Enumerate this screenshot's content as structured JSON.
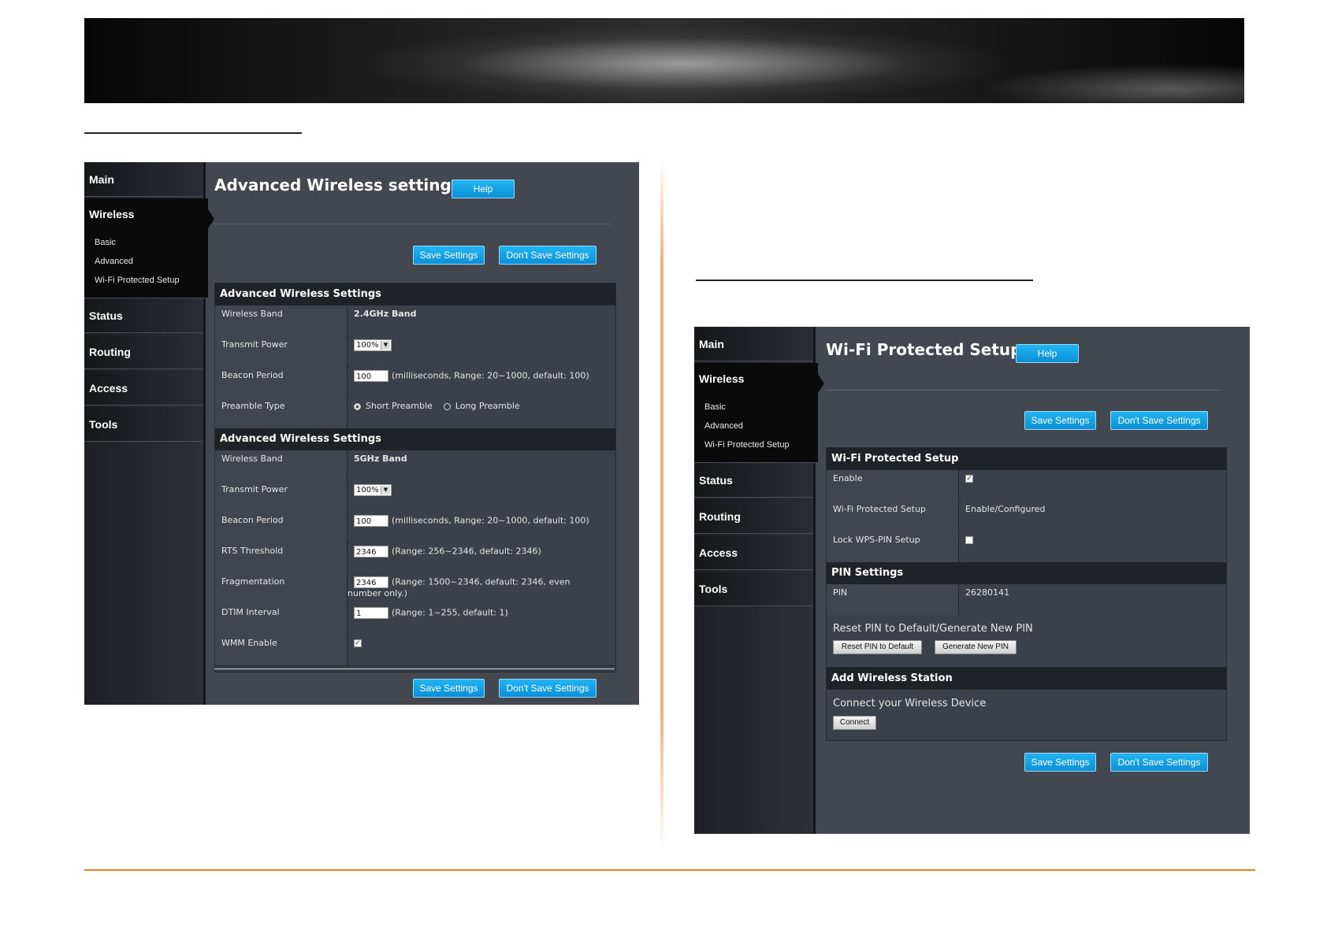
{
  "nav": {
    "main": "Main",
    "wireless": "Wireless",
    "sub": [
      "Basic",
      "Advanced",
      "Wi-Fi Protected Setup"
    ],
    "status": "Status",
    "routing": "Routing",
    "access": "Access",
    "tools": "Tools"
  },
  "advanced": {
    "title": "Advanced Wireless settings",
    "help": "Help",
    "save": "Save Settings",
    "dont_save": "Don't Save Settings",
    "section1": {
      "header": "Advanced Wireless Settings",
      "band_label": "Wireless Band",
      "band_value": "2.4GHz Band",
      "power_label": "Transmit Power",
      "power_value": "100%",
      "beacon_label": "Beacon Period",
      "beacon_value": "100",
      "beacon_hint": "(milliseconds, Range: 20~1000, default: 100)",
      "preamble_label": "Preamble Type",
      "preamble_short": "Short Preamble",
      "preamble_long": "Long Preamble"
    },
    "section2": {
      "header": "Advanced Wireless Settings",
      "band_label": "Wireless Band",
      "band_value": "5GHz Band",
      "power_label": "Transmit Power",
      "power_value": "100%",
      "beacon_label": "Beacon Period",
      "beacon_value": "100",
      "beacon_hint": "(milliseconds, Range: 20~1000, default: 100)",
      "rts_label": "RTS Threshold",
      "rts_value": "2346",
      "rts_hint": "(Range: 256~2346, default: 2346)",
      "frag_label": "Fragmentation",
      "frag_value": "2346",
      "frag_hint": "(Range: 1500~2346, default: 2346, even",
      "frag_hint2": "number only.)",
      "dtim_label": "DTIM Interval",
      "dtim_value": "1",
      "dtim_hint": "(Range: 1~255, default: 1)",
      "wmm_label": "WMM Enable"
    }
  },
  "wps": {
    "title": "Wi-Fi Protected Setup",
    "help": "Help",
    "save": "Save Settings",
    "dont_save": "Don't Save Settings",
    "section_header": "Wi-Fi Protected Setup",
    "enable_label": "Enable",
    "wps_label": "Wi-Fi Protected Setup",
    "wps_value": "Enable/Configured",
    "lock_label": "Lock WPS-PIN Setup",
    "pin_header": "PIN Settings",
    "pin_label": "PIN",
    "pin_value": "26280141",
    "reset_text": "Reset PIN to Default/Generate New PIN",
    "reset_btn": "Reset PIN to Default",
    "generate_btn": "Generate New PIN",
    "station_header": "Add Wireless Station",
    "connect_text": "Connect your Wireless Device",
    "connect_btn": "Connect"
  }
}
